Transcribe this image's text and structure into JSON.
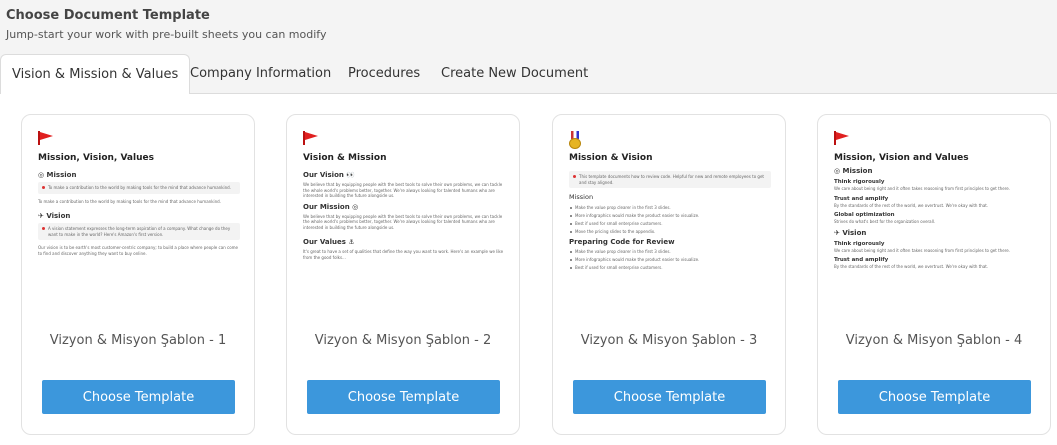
{
  "header": {
    "title": "Choose Document Template",
    "subtitle": "Jump-start your work with pre-built sheets you can modify"
  },
  "tabs": [
    {
      "label": "Vision & Mission & Values",
      "active": true
    },
    {
      "label": "Company Information",
      "active": false
    },
    {
      "label": "Procedures",
      "active": false
    },
    {
      "label": "Create New Document",
      "active": false
    }
  ],
  "colors": {
    "accent": "#3c97dc",
    "flag": "#e02020"
  },
  "cards": [
    {
      "name": "Vizyon & Misyon Şablon - 1",
      "button": "Choose Template",
      "icon": "red-flag-icon",
      "preview": {
        "title": "Mission, Vision, Values",
        "h1": "Mission",
        "callout1": "To make a contribution to the world by making tools for the mind that advance humankind.",
        "txt1": "To make a contribution to the world by making tools for the mind that advance humankind.",
        "h2": "Vision",
        "callout2": "A vision statement expresses the long-term aspiration of a company. What change do they want to make in the world? Here's Amazon's first version.",
        "txt2": "Our vision is to be earth's most customer-centric company; to build a place where people can come to find and discover anything they want to buy online."
      }
    },
    {
      "name": "Vizyon & Misyon Şablon - 2",
      "button": "Choose Template",
      "icon": "red-flag-icon",
      "preview": {
        "title": "Vision & Mission",
        "h1": "Our Vision",
        "txt1": "We believe that by equipping people with the best tools to solve their own problems, we can tackle the whole world's problems better, together. We're always looking for talented humans who are interested in building the future alongside us.",
        "h2": "Our Mission",
        "txt2": "We believe that by equipping people with the best tools to solve their own problems, we can tackle the whole world's problems better, together. We're always looking for talented humans who are interested in building the future alongside us.",
        "h3": "Our Values",
        "txt3": "It's great to have a set of qualities that define the way you want to work. Here's an example we like from the good folks..."
      }
    },
    {
      "name": "Vizyon & Misyon Şablon - 3",
      "button": "Choose Template",
      "icon": "medal-icon",
      "preview": {
        "title": "Mission & Vision",
        "callout": "This template documents how to review code. Helpful for new and remote employees to get and stay aligned.",
        "sec1": "Mission",
        "bullets1": [
          "Make the value prop clearer in the first 3 slides.",
          "More infographics would make the product easier to visualize.",
          "Best if used for small enterprise customers.",
          "Move the pricing slides to the appendix."
        ],
        "sec2": "Preparing Code for Review",
        "bullets2": [
          "Make the value prop clearer in the first 3 slides.",
          "More infographics would make the product easier to visualize.",
          "Best if used for small enterprise customers."
        ]
      }
    },
    {
      "name": "Vizyon & Misyon Şablon - 4",
      "button": "Choose Template",
      "icon": "red-flag-icon",
      "preview": {
        "title": "Mission, Vision and Values",
        "h1": "Mission",
        "items1": [
          {
            "sub": "Think rigorously",
            "txt": "We care about being right and it often takes reasoning from first principles to get there."
          },
          {
            "sub": "Trust and amplify",
            "txt": "By the standards of the rest of the world, we overtrust. We're okay with that."
          },
          {
            "sub": "Global optimization",
            "txt": "Strives do what's best for the organization overall."
          }
        ],
        "h2": "Vision",
        "items2": [
          {
            "sub": "Think rigorously",
            "txt": "We care about being right and it often takes reasoning from first principles to get there."
          },
          {
            "sub": "Trust and amplify",
            "txt": "By the standards of the rest of the world, we overtrust. We're okay with that."
          }
        ]
      }
    }
  ]
}
